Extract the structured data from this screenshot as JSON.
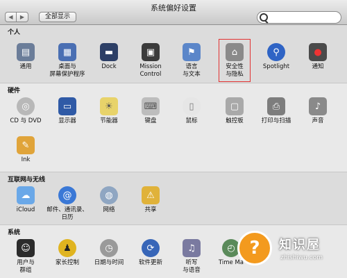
{
  "window": {
    "title": "系统偏好设置"
  },
  "toolbar": {
    "show_all_label": "全部显示",
    "search_value": ""
  },
  "sections": [
    {
      "title": "个人",
      "items": [
        {
          "label": "通用",
          "icon": "general-icon",
          "color": "#6b7d99"
        },
        {
          "label": "桌面与\n屏幕保护程序",
          "icon": "desktop-icon",
          "color": "#4a6fb3"
        },
        {
          "label": "Dock",
          "icon": "dock-icon",
          "color": "#2d3f66"
        },
        {
          "label": "Mission\nControl",
          "icon": "mission-control-icon",
          "color": "#3b3b3b"
        },
        {
          "label": "语言\n与文本",
          "icon": "language-icon",
          "color": "#5b86c9"
        },
        {
          "label": "安全性\n与隐私",
          "icon": "security-icon",
          "color": "#8a8a8a"
        },
        {
          "label": "Spotlight",
          "icon": "spotlight-icon",
          "color": "#2f64c5"
        },
        {
          "label": "通知",
          "icon": "notifications-icon",
          "color": "#4a4a4a"
        }
      ]
    },
    {
      "title": "硬件",
      "items": [
        {
          "label": "CD 与 DVD",
          "icon": "cd-dvd-icon",
          "color": "#b8b8b8"
        },
        {
          "label": "显示器",
          "icon": "displays-icon",
          "color": "#2f5aa6"
        },
        {
          "label": "节能器",
          "icon": "energy-saver-icon",
          "color": "#e8d36a"
        },
        {
          "label": "键盘",
          "icon": "keyboard-icon",
          "color": "#bdbdbd"
        },
        {
          "label": "鼠标",
          "icon": "mouse-icon",
          "color": "#e6e6e6"
        },
        {
          "label": "触控板",
          "icon": "trackpad-icon",
          "color": "#a9a9a9"
        },
        {
          "label": "打印与扫描",
          "icon": "printer-icon",
          "color": "#7d7d7d"
        },
        {
          "label": "声音",
          "icon": "sound-icon",
          "color": "#8a8a8a"
        },
        {
          "label": "Ink",
          "icon": "ink-icon",
          "color": "#e0a43a"
        }
      ]
    },
    {
      "title": "互联网与无线",
      "items": [
        {
          "label": "iCloud",
          "icon": "icloud-icon",
          "color": "#6aa8e8"
        },
        {
          "label": "邮件、通讯录、\n日历",
          "icon": "mail-contacts-icon",
          "color": "#3a78d6"
        },
        {
          "label": "网络",
          "icon": "network-icon",
          "color": "#8fa6c2"
        },
        {
          "label": "共享",
          "icon": "sharing-icon",
          "color": "#e0b23a"
        }
      ]
    },
    {
      "title": "系统",
      "items": [
        {
          "label": "用户与\n群组",
          "icon": "users-groups-icon",
          "color": "#2b2b2b"
        },
        {
          "label": "家长控制",
          "icon": "parental-controls-icon",
          "color": "#e0b420"
        },
        {
          "label": "日期与时间",
          "icon": "date-time-icon",
          "color": "#9a9a9a"
        },
        {
          "label": "软件更新",
          "icon": "software-update-icon",
          "color": "#3866b8"
        },
        {
          "label": "听写\n与语音",
          "icon": "dictation-icon",
          "color": "#7a7aa0"
        },
        {
          "label": "Time Ma",
          "icon": "time-machine-icon",
          "color": "#5a8a5a"
        }
      ]
    }
  ],
  "watermark": {
    "name": "知识屋",
    "url": "zhishiwu.com",
    "badge": "?"
  }
}
